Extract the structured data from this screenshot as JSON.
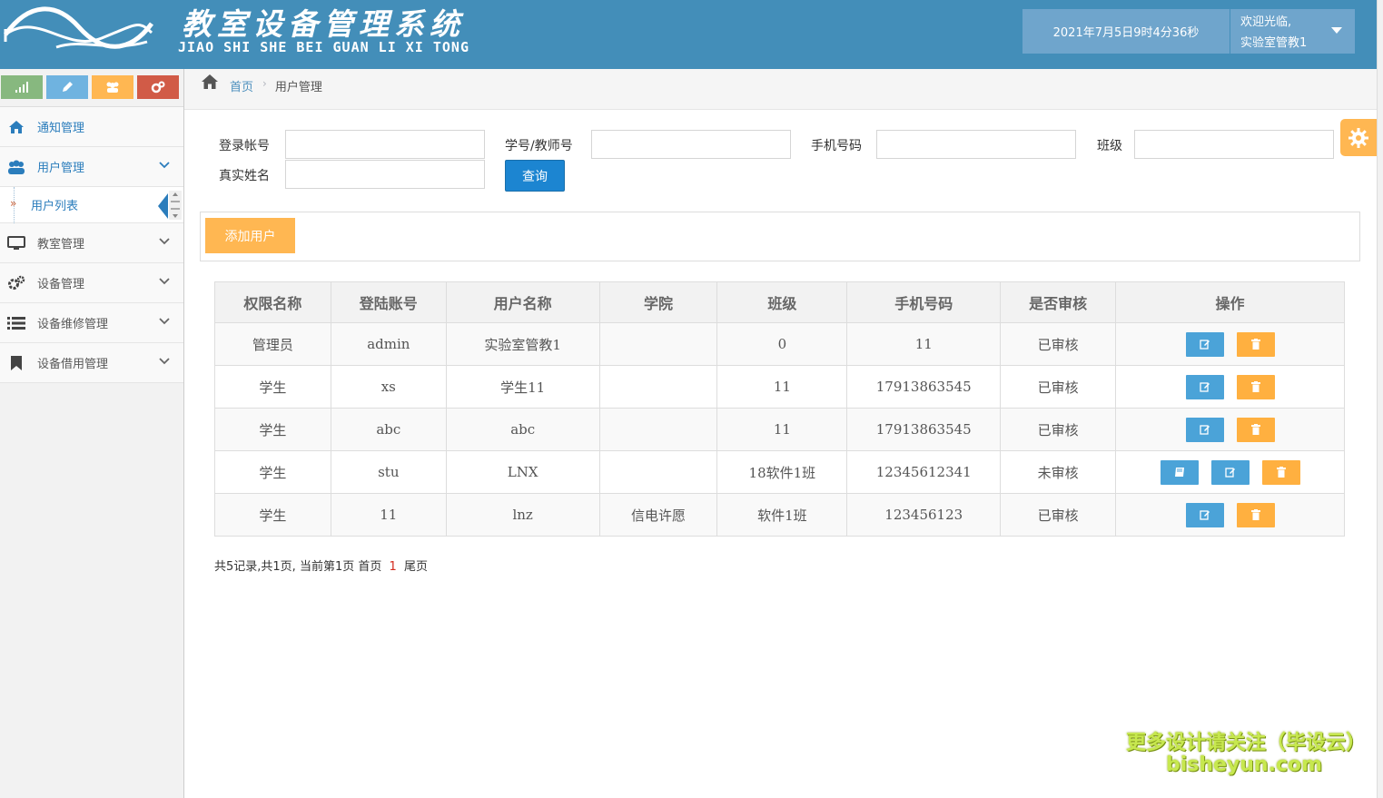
{
  "header": {
    "title_cn": "教室设备管理系统",
    "title_en": "JIAO SHI SHE BEI GUAN LI XI TONG",
    "datetime": "2021年7月5日9时4分36秒",
    "welcome": "欢迎光临,",
    "username": "实验室管教1"
  },
  "sidebar": {
    "shortcuts": [
      "signal-icon",
      "pencil-icon",
      "users-icon",
      "cogs-icon"
    ],
    "items": [
      {
        "label": "通知管理",
        "icon": "home-icon"
      },
      {
        "label": "用户管理",
        "icon": "users-icon"
      },
      {
        "label": "教室管理",
        "icon": "desktop-icon"
      },
      {
        "label": "设备管理",
        "icon": "cogs-icon"
      },
      {
        "label": "设备维修管理",
        "icon": "list-icon"
      },
      {
        "label": "设备借用管理",
        "icon": "bookmark-icon"
      }
    ],
    "subitem": {
      "label": "用户列表",
      "marker": "»"
    }
  },
  "breadcrumb": {
    "home": "首页",
    "current": "用户管理"
  },
  "search": {
    "login_label": "登录帐号",
    "id_label": "学号/教师号",
    "phone_label": "手机号码",
    "class_label": "班级",
    "name_label": "真实姓名",
    "login_value": "",
    "id_value": "",
    "phone_value": "",
    "class_value": "",
    "name_value": "",
    "query_button": "查询"
  },
  "toolbar": {
    "add_button": "添加用户"
  },
  "table": {
    "headers": [
      "权限名称",
      "登陆账号",
      "用户名称",
      "学院",
      "班级",
      "手机号码",
      "是否审核",
      "操作"
    ],
    "rows": [
      {
        "role": "管理员",
        "account": "admin",
        "name": "实验室管教1",
        "college": "",
        "class": "0",
        "phone": "11",
        "status": "已审核"
      },
      {
        "role": "学生",
        "account": "xs",
        "name": "学生11",
        "college": "",
        "class": "11",
        "phone": "17913863545",
        "status": "已审核"
      },
      {
        "role": "学生",
        "account": "abc",
        "name": "abc",
        "college": "",
        "class": "11",
        "phone": "17913863545",
        "status": "已审核"
      },
      {
        "role": "学生",
        "account": "stu",
        "name": "LNX",
        "college": "",
        "class": "18软件1班",
        "phone": "12345612341",
        "status": "未审核"
      },
      {
        "role": "学生",
        "account": "11",
        "name": "lnz",
        "college": "信电许愿",
        "class": "软件1班",
        "phone": "123456123",
        "status": "已审核"
      }
    ]
  },
  "pagination": {
    "summary": "共5记录,共1页, 当前第1页",
    "first": "首页",
    "current": "1",
    "last": "尾页"
  },
  "watermark": {
    "line1": "更多设计请关注（毕设云）",
    "line2": "bisheyun.com"
  },
  "colors": {
    "header_bg": "#438eb9",
    "accent_blue": "#2b7dbc",
    "orange": "#ffb752",
    "approved": "#1e3ea8",
    "pending": "#d42a1e"
  }
}
